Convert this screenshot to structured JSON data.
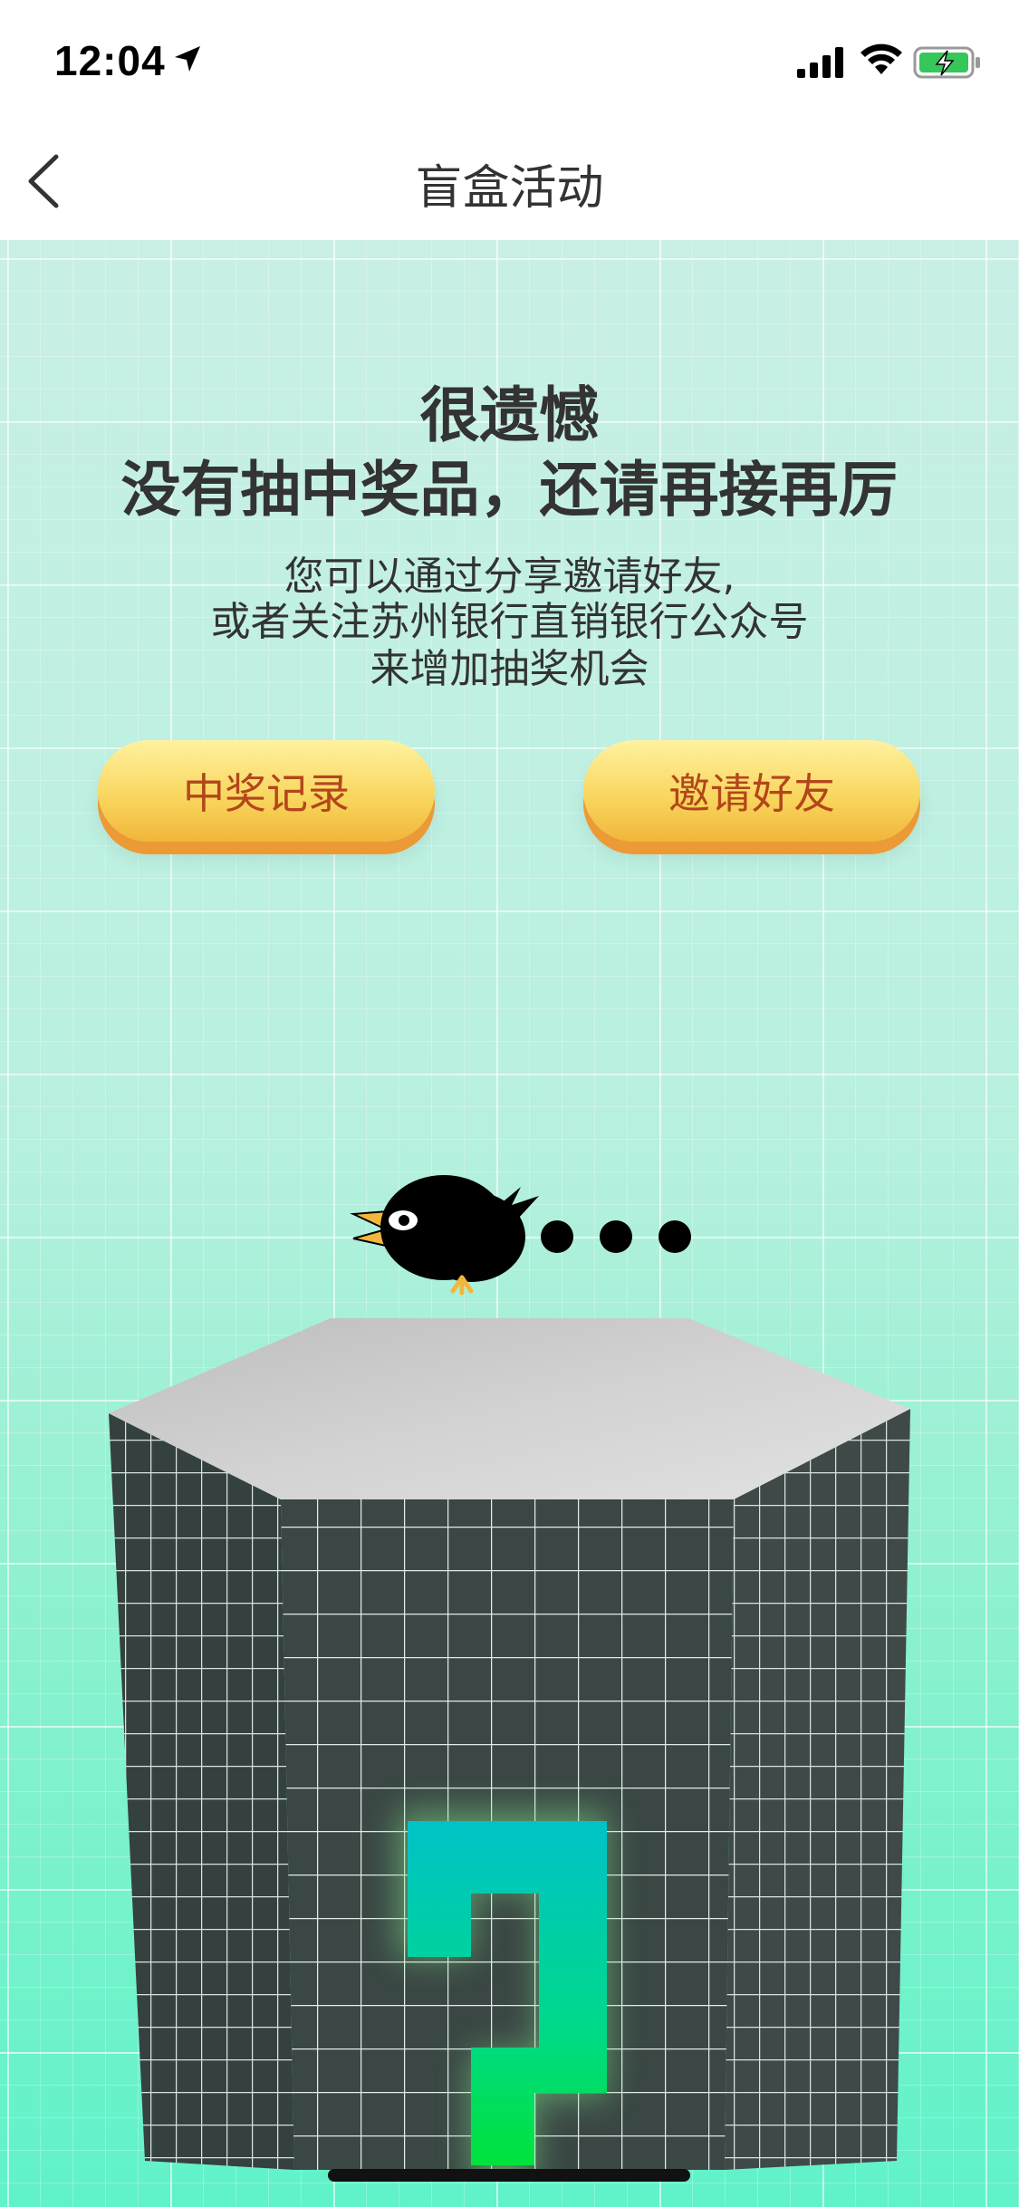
{
  "status_bar": {
    "time": "12:04"
  },
  "nav": {
    "title": "盲盒活动"
  },
  "result": {
    "headline_line1": "很遗憾",
    "headline_line2": "没有抽中奖品，还请再接再厉",
    "subtext_line1": "您可以通过分享邀请好友,",
    "subtext_line2": "或者关注苏州银行直销银行公众号",
    "subtext_line3": "来增加抽奖机会"
  },
  "buttons": {
    "records_label": "中奖记录",
    "invite_label": "邀请好友"
  },
  "icons": {
    "back": "chevron-left-icon",
    "location": "location-arrow-icon",
    "signal": "cellular-signal-icon",
    "wifi": "wifi-icon",
    "battery": "battery-charging-icon"
  },
  "colors": {
    "button_text": "#b3461b",
    "button_fill": "#f8d45a",
    "background_top": "#c9efe6",
    "background_bottom": "#60f2c9",
    "box_dark": "#384643",
    "question_mark": "#00c2c8"
  }
}
